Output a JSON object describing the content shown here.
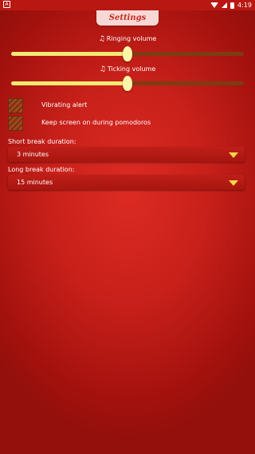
{
  "status_bar": {
    "left_icon": "A",
    "time": "4:19",
    "icons": [
      "wifi-icon",
      "signal-icon",
      "battery-icon"
    ]
  },
  "header": {
    "title": "Settings"
  },
  "ringing": {
    "label": "Ringing volume",
    "icon": "music-note-icon",
    "value_fraction": 0.5
  },
  "ticking": {
    "label": "Ticking volume",
    "icon": "music-note-icon",
    "value_fraction": 0.5
  },
  "options": {
    "vibrating": {
      "label": "Vibrating alert",
      "checked": false
    },
    "keep_screen": {
      "label": "Keep screen on during pomodoros",
      "checked": false
    }
  },
  "short_break": {
    "label": "Short break duration:",
    "value": "3 minutes"
  },
  "long_break": {
    "label": "Long break duration:",
    "value": "15 minutes"
  },
  "colors": {
    "background": "#c8201a",
    "track": "#7e3c12",
    "fill": "#f3ea72",
    "arrow": "#f3d64a",
    "title_tab": "#f7d8d4"
  }
}
